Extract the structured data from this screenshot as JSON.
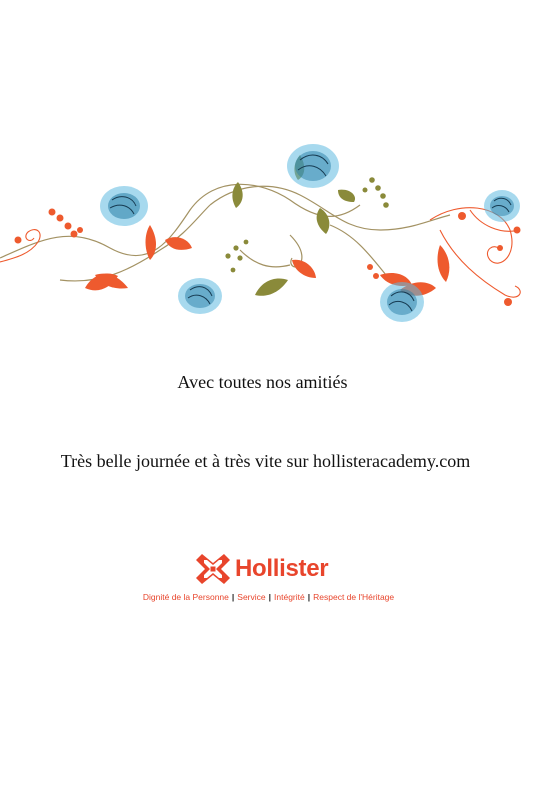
{
  "greeting": "Avec toutes nos amitiés",
  "message": "Très belle journée et à très vite sur hollisteracademy.com",
  "brand": {
    "name": "Hollister",
    "color": "#e8452c",
    "values": [
      "Dignité de la Personne",
      "Service",
      "Intégrité",
      "Respect de l'Héritage"
    ],
    "separator": "|"
  },
  "decoration": {
    "icon": "floral-vine-illustration",
    "colors": {
      "blossom": "#4aaed6",
      "petal": "#ee5a2e",
      "leaf": "#8a8a3a",
      "vine": "#9a8a5a"
    }
  }
}
